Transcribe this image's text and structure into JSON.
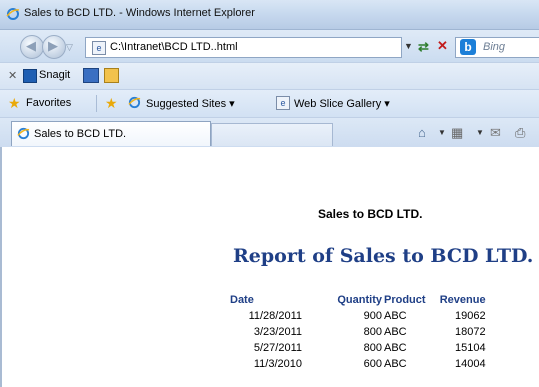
{
  "window": {
    "title": "Sales to BCD LTD. - Windows Internet Explorer"
  },
  "address_bar": {
    "url": "C:\\Intranet\\BCD LTD..html",
    "search_engine": "Bing"
  },
  "snagit_toolbar": {
    "label": "Snagit"
  },
  "favorites_bar": {
    "favorites_label": "Favorites",
    "items": [
      {
        "label": "Suggested Sites ▾",
        "icon": "ie-icon"
      },
      {
        "label": "Web Slice Gallery ▾",
        "icon": "page-icon"
      }
    ]
  },
  "tabs": [
    {
      "label": "Sales to BCD LTD.",
      "active": true
    }
  ],
  "page": {
    "heading": "Sales to BCD LTD.",
    "report_title": "Report of Sales to BCD LTD.",
    "table": {
      "columns": [
        "Date",
        "Quantity",
        "Product",
        "Revenue"
      ],
      "rows": [
        {
          "date": "11/28/2011",
          "quantity": "900",
          "product": "ABC",
          "revenue": "19062"
        },
        {
          "date": "3/23/2011",
          "quantity": "800",
          "product": "ABC",
          "revenue": "18072"
        },
        {
          "date": "5/27/2011",
          "quantity": "800",
          "product": "ABC",
          "revenue": "15104"
        },
        {
          "date": "11/3/2010",
          "quantity": "600",
          "product": "ABC",
          "revenue": "14004"
        }
      ]
    }
  },
  "colors": {
    "report_title": "#1f3f86",
    "chrome": "#cddcf0"
  }
}
